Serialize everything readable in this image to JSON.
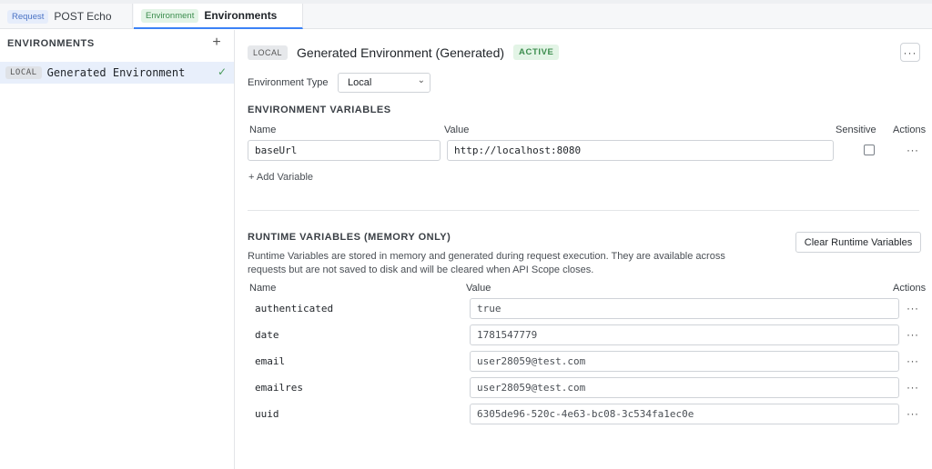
{
  "tabs": [
    {
      "badge": "Request",
      "label": "POST Echo"
    },
    {
      "badge": "Environment",
      "label": "Environments"
    }
  ],
  "sidebar": {
    "header": "ENVIRONMENTS",
    "add_icon": "+",
    "items": [
      {
        "badge": "LOCAL",
        "name": "Generated Environment",
        "check": "✓"
      }
    ]
  },
  "main": {
    "badge": "LOCAL",
    "title": "Generated Environment (Generated)",
    "status": "ACTIVE",
    "more_icon": "···",
    "env_type_label": "Environment Type",
    "env_type_value": "Local",
    "env_vars": {
      "section_title": "ENVIRONMENT VARIABLES",
      "columns": {
        "name": "Name",
        "value": "Value",
        "sensitive": "Sensitive",
        "actions": "Actions"
      },
      "rows": [
        {
          "name": "baseUrl",
          "value": "http://localhost:8080",
          "sensitive": false
        }
      ],
      "add_label": "+ Add Variable"
    },
    "runtime": {
      "section_title": "RUNTIME VARIABLES (MEMORY ONLY)",
      "clear_label": "Clear Runtime Variables",
      "description": "Runtime Variables are stored in memory and generated during request execution. They are available across requests but are not saved to disk and will be cleared when API Scope closes.",
      "columns": {
        "name": "Name",
        "value": "Value",
        "actions": "Actions"
      },
      "rows": [
        {
          "name": "authenticated",
          "value": "true"
        },
        {
          "name": "date",
          "value": "1781547779"
        },
        {
          "name": "email",
          "value": "user28059@test.com"
        },
        {
          "name": "emailres",
          "value": "user28059@test.com"
        },
        {
          "name": "uuid",
          "value": "6305de96-520c-4e63-bc08-3c534fa1ec0e"
        }
      ]
    }
  },
  "icons": {
    "dots": "···",
    "chevron": "⌄"
  },
  "colors": {
    "accent": "#3b82f6",
    "active_green": "#3c8d4e",
    "selected_bg": "#e8effb"
  }
}
